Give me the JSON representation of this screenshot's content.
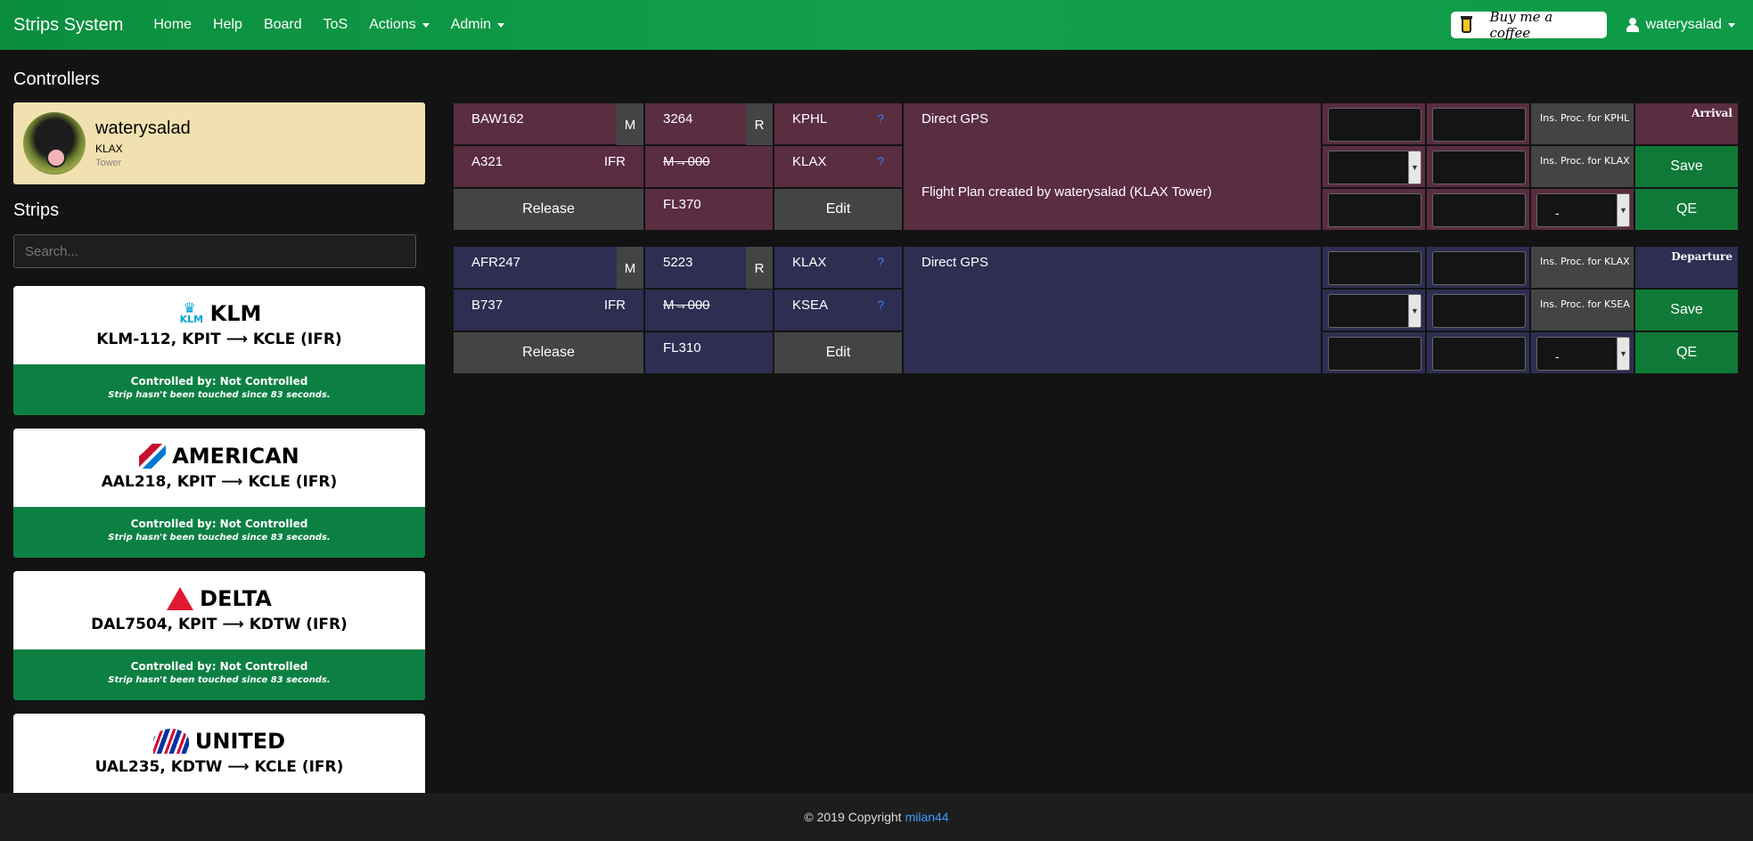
{
  "navbar": {
    "brand": "Strips System",
    "links": [
      "Home",
      "Help",
      "Board",
      "ToS"
    ],
    "actions": "Actions",
    "admin": "Admin",
    "coffee": "Buy me a coffee",
    "user": "waterysalad"
  },
  "sidebar": {
    "controllers_heading": "Controllers",
    "controller": {
      "name": "waterysalad",
      "airport": "KLAX",
      "position": "Tower"
    },
    "strips_heading": "Strips",
    "search_placeholder": "Search...",
    "cards": [
      {
        "airline": "KLM",
        "logo": "klm-logo",
        "route": "KLM-112, KPIT ⟶ KCLE (IFR)",
        "controlled": "Controlled by: Not Controlled",
        "touched": "Strip hasn't been touched since 83 seconds."
      },
      {
        "airline": "AMERICAN",
        "logo": "american-logo",
        "route": "AAL218, KPIT ⟶ KCLE (IFR)",
        "controlled": "Controlled by: Not Controlled",
        "touched": "Strip hasn't been touched since 83 seconds."
      },
      {
        "airline": "DELTA",
        "logo": "delta-logo",
        "route": "DAL7504, KPIT ⟶ KDTW (IFR)",
        "controlled": "Controlled by: Not Controlled",
        "touched": "Strip hasn't been touched since 83 seconds."
      },
      {
        "airline": "UNITED",
        "logo": "united-logo",
        "route": "UAL235, KDTW ⟶ KCLE (IFR)"
      }
    ]
  },
  "strips": [
    {
      "type": "Arrival",
      "callsign": "BAW162",
      "wake": "M",
      "aircraft": "A321",
      "rules": "IFR",
      "squawk": "3264",
      "squawk_tag": "R",
      "speed": "M→000",
      "altitude": "FL370",
      "origin": "KPHL",
      "destination": "KLAX",
      "q": "?",
      "route": "Direct GPS",
      "remarks": "Flight Plan created by waterysalad (KLAX Tower)",
      "ins1": "Ins. Proc. for KPHL",
      "ins2": "Ins. Proc. for KLAX",
      "release": "Release",
      "edit": "Edit",
      "save": "Save",
      "qe": "QE",
      "select": "-"
    },
    {
      "type": "Departure",
      "callsign": "AFR247",
      "wake": "M",
      "aircraft": "B737",
      "rules": "IFR",
      "squawk": "5223",
      "squawk_tag": "R",
      "speed": "M→000",
      "altitude": "FL310",
      "origin": "KLAX",
      "destination": "KSEA",
      "q": "?",
      "route": "Direct GPS",
      "remarks": "",
      "ins1": "Ins. Proc. for KLAX",
      "ins2": "Ins. Proc. for KSEA",
      "release": "Release",
      "edit": "Edit",
      "save": "Save",
      "qe": "QE",
      "select": "-"
    }
  ],
  "footer": {
    "text": "© 2019 Copyright",
    "link": "milan44"
  },
  "colors": {
    "nav": "#0a8e3e",
    "arrival": "#5a2d41",
    "departure": "#2e2e52",
    "control_green": "#0c8043",
    "controller_card": "#f2e1b0"
  }
}
